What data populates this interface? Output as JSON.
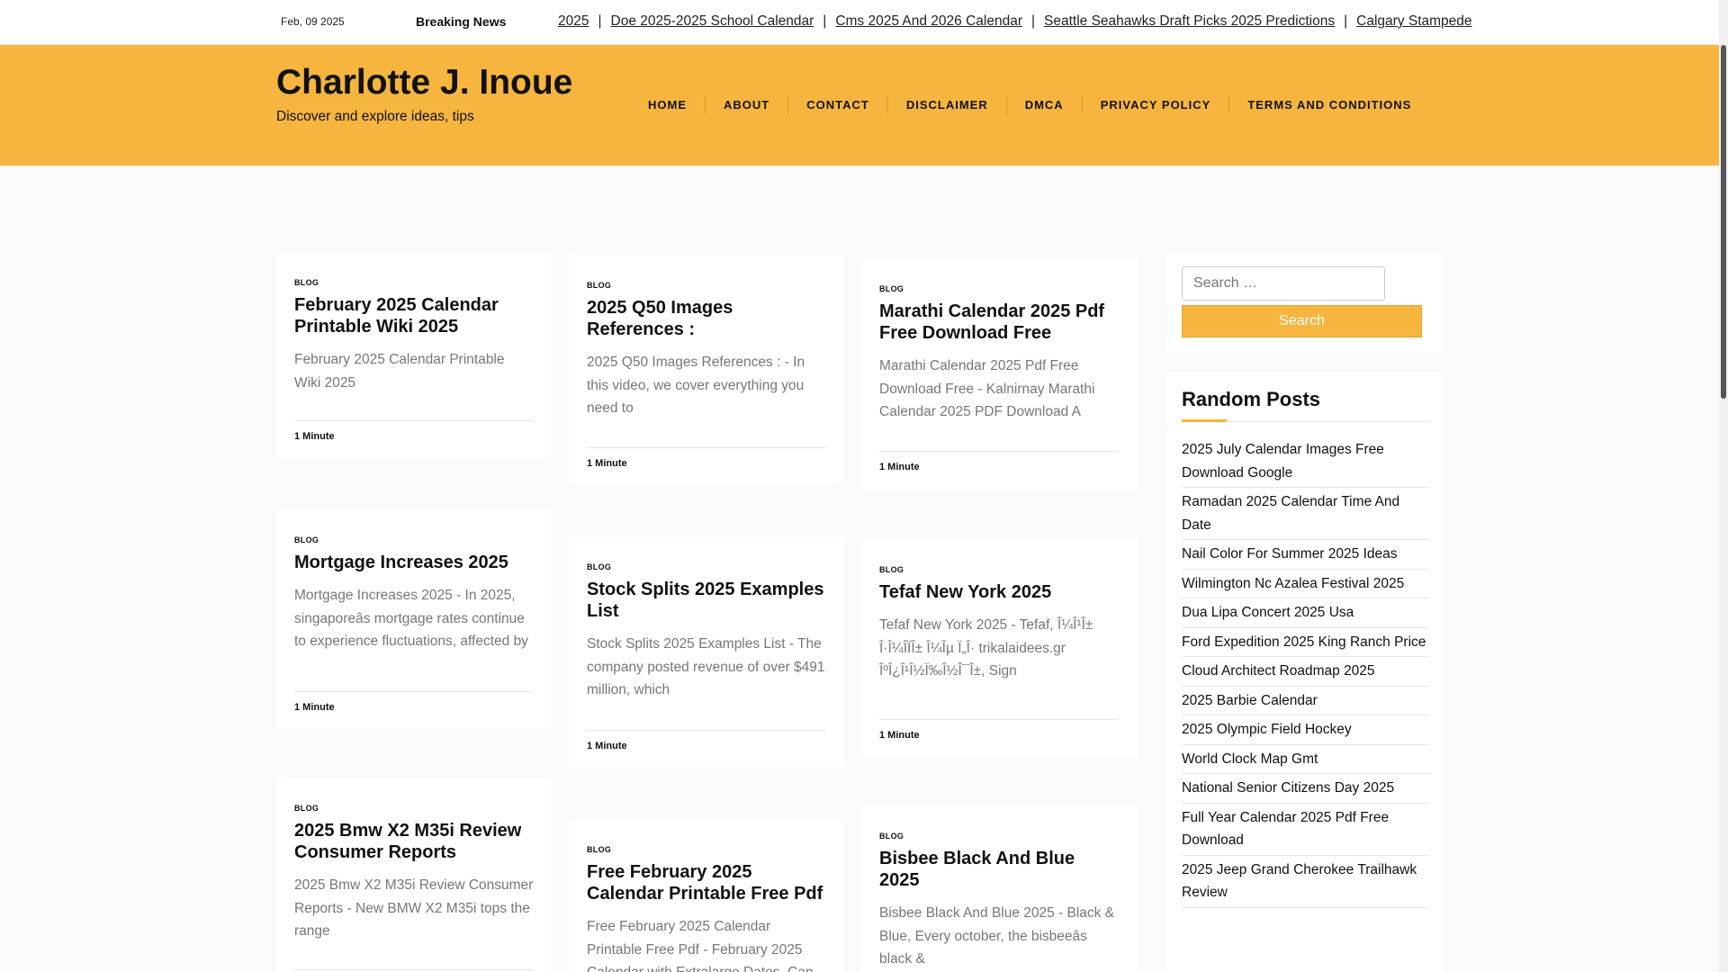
{
  "topbar": {
    "date": "Feb, 09 2025",
    "breaking_label": "Breaking News",
    "ticker": [
      "2025",
      "Doe 2025-2025 School Calendar",
      "Cms 2025 And 2026 Calendar",
      "Seattle Seahawks Draft Picks 2025 Predictions",
      "Calgary Stampede"
    ],
    "separator": "|"
  },
  "header": {
    "site_title": "Charlotte J. Inoue",
    "tagline": "Discover and explore ideas, tips",
    "nav": [
      "HOME",
      "ABOUT",
      "CONTACT",
      "DISCLAIMER",
      "DMCA",
      "PRIVACY POLICY",
      "TERMS AND CONDITIONS"
    ]
  },
  "posts": [
    {
      "category": "BLOG",
      "title": "February 2025 Calendar Printable Wiki 2025",
      "excerpt": "February 2025 Calendar Printable Wiki 2025",
      "read_time": "1 Minute"
    },
    {
      "category": "BLOG",
      "title": "2025 Q50 Images References :",
      "excerpt": "2025 Q50 Images References : - In this video, we cover everything you need to",
      "read_time": "1 Minute"
    },
    {
      "category": "BLOG",
      "title": "Marathi Calendar 2025 Pdf Free Download Free",
      "excerpt": "Marathi Calendar 2025 Pdf Free Download Free - Kalnirnay Marathi Calendar 2025 PDF Download A",
      "read_time": "1 Minute"
    },
    {
      "category": "BLOG",
      "title": "Mortgage Increases 2025",
      "excerpt": "Mortgage Increases 2025 - In 2025, singaporeâs mortgage rates continue to experience fluctuations, affected by",
      "read_time": "1 Minute"
    },
    {
      "category": "BLOG",
      "title": "Stock Splits 2025 Examples List",
      "excerpt": "Stock Splits 2025 Examples List - The company posted revenue of over $491 million, which",
      "read_time": "1 Minute"
    },
    {
      "category": "BLOG",
      "title": "Tefaf New York 2025",
      "excerpt": "Tefaf New York 2025 - Tefaf, Î¼Î¹Î± Î·Î¼Î­ÏÎ± Î¼Îµ Ï„Î· trikalaidees.gr ÎºÎ¿Î¹Î½Ï‰Î½Î¯Î±, Sign",
      "read_time": "1 Minute"
    },
    {
      "category": "BLOG",
      "title": "2025 Bmw X2 M35i Review Consumer Reports",
      "excerpt": "2025 Bmw X2 M35i Review Consumer Reports - New BMW X2 M35i tops the range",
      "read_time": ""
    },
    {
      "category": "BLOG",
      "title": "Free February 2025 Calendar Printable Free Pdf",
      "excerpt": "Free February 2025 Calendar Printable Free Pdf - February 2025 Calendar with Extralarge Dates, Can",
      "read_time": ""
    },
    {
      "category": "BLOG",
      "title": "Bisbee Black And Blue 2025",
      "excerpt": "Bisbee Black And Blue 2025 - Black & Blue, Every october, the bisbeeâs black &",
      "read_time": ""
    }
  ],
  "sidebar": {
    "search_placeholder": "Search …",
    "search_button": "Search",
    "random_title": "Random Posts",
    "random_posts": [
      "2025 July Calendar Images Free Download Google",
      "Ramadan 2025 Calendar Time And Date",
      "Nail Color For Summer 2025 Ideas",
      "Wilmington Nc Azalea Festival 2025",
      "Dua Lipa Concert 2025 Usa",
      "Ford Expedition 2025 King Ranch Price",
      "Cloud Architect Roadmap 2025",
      "2025 Barbie Calendar",
      "2025 Olympic Field Hockey",
      "World Clock Map Gmt",
      "National Senior Citizens Day 2025",
      "Full Year Calendar 2025 Pdf Free Download",
      "2025 Jeep Grand Cherokee Trailhawk Review"
    ]
  },
  "colors": {
    "accent": "#f5b53f",
    "background": "#fbf9fb",
    "excerpt_text": "#777777"
  }
}
